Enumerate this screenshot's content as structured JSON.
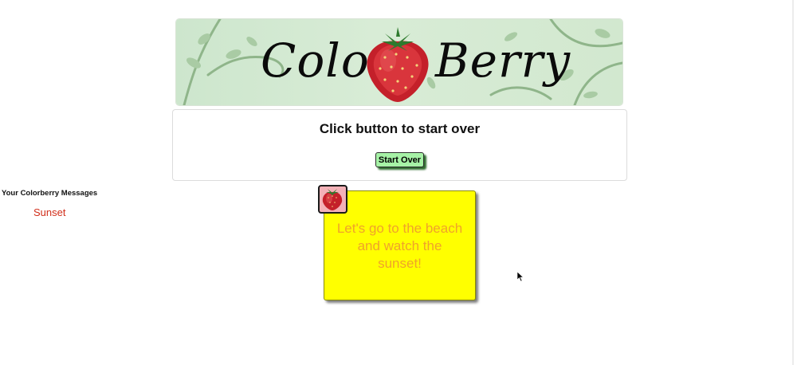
{
  "banner": {
    "title_left": "Color",
    "title_right": "Berry"
  },
  "card": {
    "heading": "Click button to start over",
    "button_label": "Start Over"
  },
  "messages": {
    "heading": "Your Colorberry Messages",
    "items": [
      "Sunset"
    ]
  },
  "note": {
    "text": "Let's go to the beach and watch the sunset!",
    "background_color": "#ffff00",
    "text_color": "#f0a32a"
  },
  "colors": {
    "button_bg": "#a6f2a6",
    "message_link": "#d12e1a",
    "badge_bg": "#f3b1b7"
  }
}
